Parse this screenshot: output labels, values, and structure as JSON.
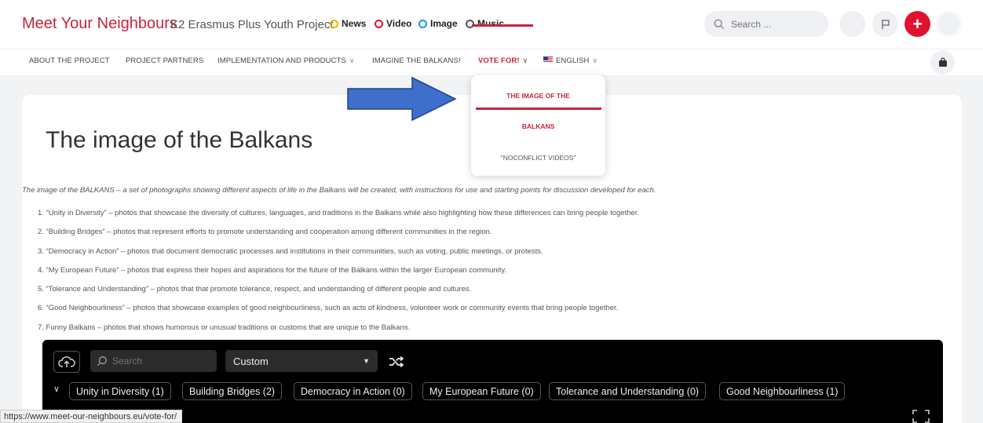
{
  "header": {
    "brand": "Meet Your Neighbours",
    "subbrand": "K2 Erasmus Plus Youth Project",
    "post_formats": [
      {
        "label": "News",
        "color": "#f0b400"
      },
      {
        "label": "Video",
        "color": "#e0132e"
      },
      {
        "label": "Image",
        "color": "#1a9bd7"
      },
      {
        "label": "Music",
        "color": "#555555"
      }
    ],
    "search_placeholder": "Search ..."
  },
  "nav": {
    "items": [
      {
        "label": "About the project"
      },
      {
        "label": "Project partners"
      },
      {
        "label": "Implementation and products"
      },
      {
        "label": "Imagine the Balkans!"
      },
      {
        "label": "Vote for!"
      },
      {
        "label": "English"
      }
    ]
  },
  "dropdown": {
    "items": [
      "The image of the",
      "Balkans",
      "\"NoConflict videos\""
    ]
  },
  "page": {
    "title": "The image of the Balkans",
    "intro": "The image of the BALKANS – a set of photographs showing different aspects of life in the Balkans will be created, with instructions for use and starting points for discussion developed for each.",
    "list": [
      "1. “Unity in Diversity” – photos that showcase the diversity of cultures, languages, and traditions in the Balkans while also highlighting how these differences can bring people together.",
      "2. “Building Bridges” – photos that represent efforts to promote understanding and cooperation among different communities in the region.",
      "3. “Democracy in Action” – photos that document democratic processes and institutions in their communities, such as voting, public meetings, or protests.",
      "4. “My European Future” – photos that express their hopes and aspirations for the future of the Balkans within the larger European community.",
      "5. “Tolerance and Understanding” – photos that that promote tolerance, respect, and understanding of different people and cultures.",
      "6. “Good Neighbourliness” – photos that showcase examples of good neighbourliness, such as acts of kindness, volunteer work or community events that bring people together.",
      "7. Funny Balkans – photos that shows humorous or unusual traditions or customs that are unique to the Balkans."
    ]
  },
  "gallery": {
    "search_placeholder": "Search",
    "sort_value": "Custom",
    "categories": [
      {
        "label": "Unity in Diversity (1)"
      },
      {
        "label": "Building Bridges (2)"
      },
      {
        "label": "Democracy in Action (0)"
      },
      {
        "label": "My European Future (0)"
      },
      {
        "label": "Tolerance and Understanding (0)"
      },
      {
        "label": "Good Neighbourliness (1)"
      }
    ]
  },
  "status_url": "https://www.meet-our-neighbours.eu/vote-for/",
  "colors": {
    "accent": "#c8243a",
    "plus_button": "#e0132e",
    "arrow": "#3f6fcc"
  }
}
